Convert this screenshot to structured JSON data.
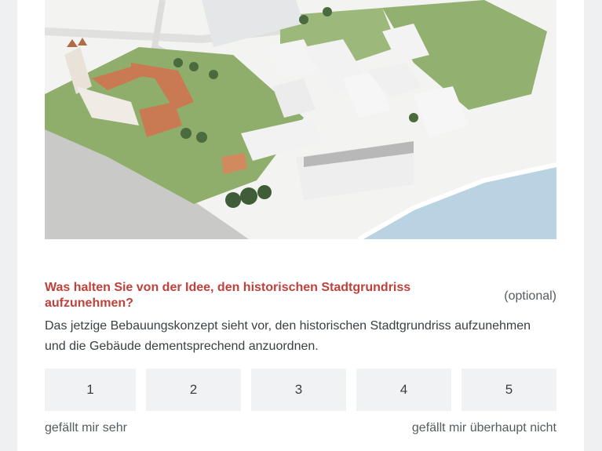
{
  "question": {
    "title": "Was halten Sie von der Idee, den historischen Stadtgrundriss aufzunehmen?",
    "optional_label": "(optional)",
    "description": "Das jetzige Bebauungskonzept sieht vor, den historischen Stadtgrundriss aufzunehmen und die Gebäude dementsprechend anzuordnen."
  },
  "scale": {
    "options": [
      "1",
      "2",
      "3",
      "4",
      "5"
    ],
    "min_label": "gefällt mir sehr",
    "max_label": "gefällt mir überhaupt nicht"
  },
  "colors": {
    "question_title": "#c0413a",
    "button_bg": "#f1f2f3",
    "water": "#b9d3e3",
    "grass": "#8aa86a"
  }
}
